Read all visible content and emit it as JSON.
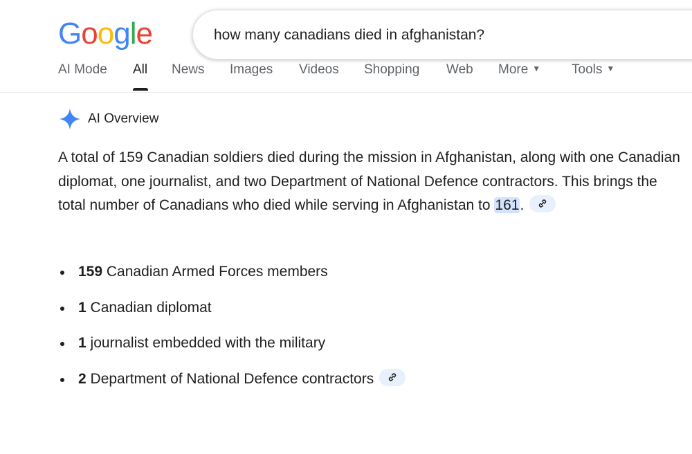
{
  "logo": {
    "letters": [
      {
        "char": "G",
        "color": "#4285F4"
      },
      {
        "char": "o",
        "color": "#EA4335"
      },
      {
        "char": "o",
        "color": "#FBBC05"
      },
      {
        "char": "g",
        "color": "#4285F4"
      },
      {
        "char": "l",
        "color": "#34A853"
      },
      {
        "char": "e",
        "color": "#EA4335"
      }
    ]
  },
  "search": {
    "query": "how many canadians died in afghanistan?"
  },
  "tabs": [
    {
      "label": "AI Mode"
    },
    {
      "label": "All"
    },
    {
      "label": "News"
    },
    {
      "label": "Images"
    },
    {
      "label": "Videos"
    },
    {
      "label": "Shopping"
    },
    {
      "label": "Web"
    },
    {
      "label": "More"
    },
    {
      "label": "Tools"
    }
  ],
  "ai_overview": {
    "header_label": "AI Overview",
    "paragraph_prefix": "A total of 159 Canadian soldiers died during the mission in Afghanistan, along with one Canadian diplomat, one journalist, and two Department of National Defence contractors. This brings the total number of Canadians who died while serving in Afghanistan to ",
    "paragraph_highlight": "161",
    "paragraph_suffix": ".",
    "bullets": [
      {
        "count": "159",
        "text": " Canadian Armed Forces members"
      },
      {
        "count": "1",
        "text": " Canadian diplomat"
      },
      {
        "count": "1",
        "text": " journalist embedded with the military"
      },
      {
        "count": "2",
        "text": " Department of National Defence contractors"
      }
    ]
  },
  "colors": {
    "highlight": "#d3e3fd",
    "citation_chip": "#e8f0fe",
    "sparkle": "#4285F4"
  }
}
